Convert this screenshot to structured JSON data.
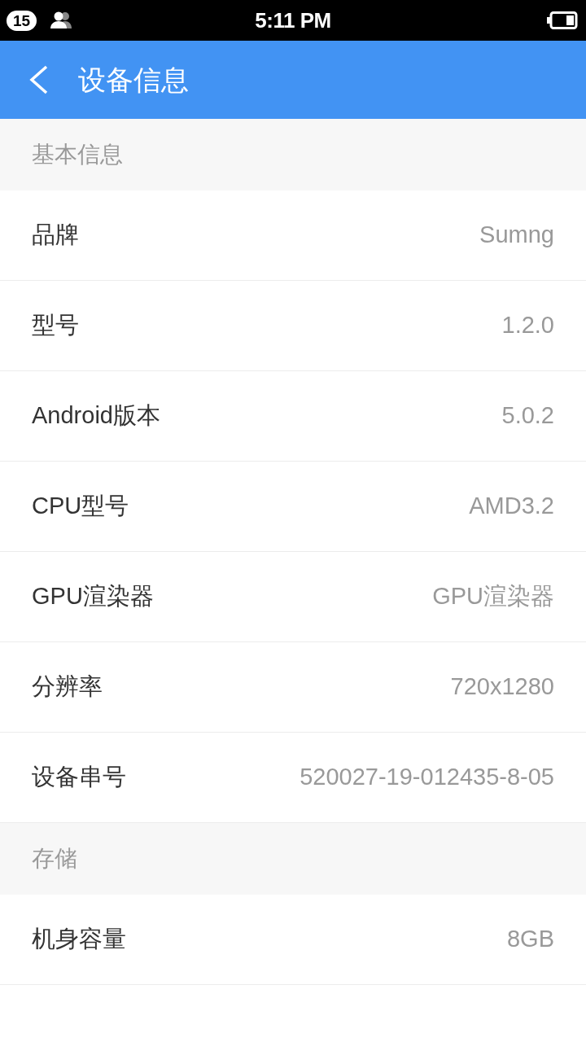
{
  "status_bar": {
    "notification_count": "15",
    "time": "5:11 PM"
  },
  "app_bar": {
    "title": "设备信息"
  },
  "sections": [
    {
      "title": "基本信息",
      "rows": [
        {
          "label": "品牌",
          "value": "Sumng"
        },
        {
          "label": "型号",
          "value": "1.2.0"
        },
        {
          "label": "Android版本",
          "value": "5.0.2"
        },
        {
          "label": "CPU型号",
          "value": "AMD3.2"
        },
        {
          "label": "GPU渲染器",
          "value": "GPU渲染器"
        },
        {
          "label": "分辨率",
          "value": "720x1280"
        },
        {
          "label": "设备串号",
          "value": "520027-19-012435-8-05"
        }
      ]
    },
    {
      "title": "存储",
      "rows": [
        {
          "label": "机身容量",
          "value": "8GB"
        }
      ]
    }
  ]
}
